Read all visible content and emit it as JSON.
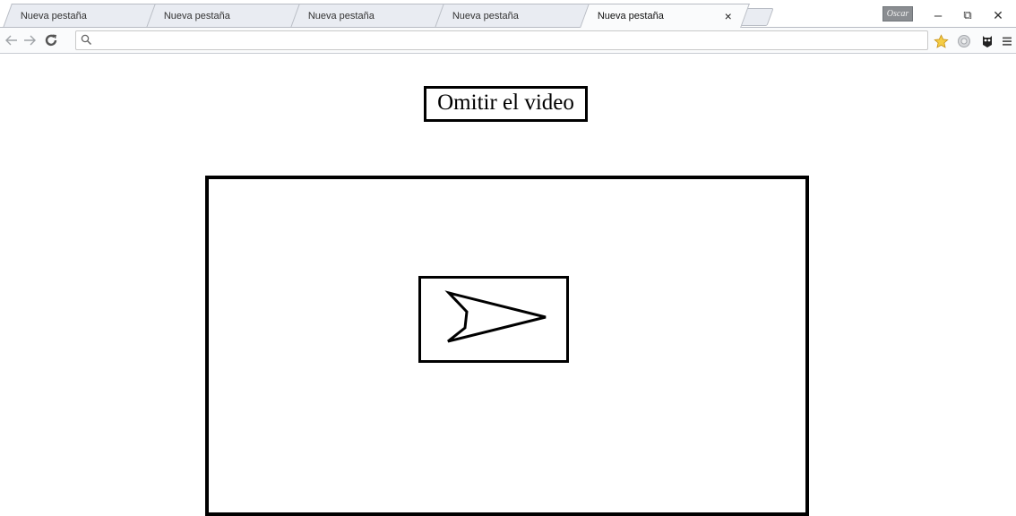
{
  "browser": {
    "tabs": [
      {
        "title": "Nueva pestaña",
        "close_glyph": "×",
        "active": false
      },
      {
        "title": "Nueva pestaña",
        "close_glyph": "×",
        "active": false
      },
      {
        "title": "Nueva pestaña",
        "close_glyph": "×",
        "active": false
      },
      {
        "title": "Nueva pestaña",
        "close_glyph": "×",
        "active": false
      },
      {
        "title": "Nueva pestaña",
        "close_glyph": "×",
        "active": true
      }
    ],
    "profile_name": "Oscar",
    "window_controls": {
      "minimize": "–",
      "restore": "⧉",
      "close": "✕"
    },
    "omnibox": {
      "value": "",
      "placeholder": ""
    },
    "icons": {
      "back": "back-arrow-icon",
      "forward": "forward-arrow-icon",
      "reload": "reload-icon",
      "search": "search-icon",
      "bookmark_star": "star-icon",
      "extension_1": "extension-circle-icon",
      "extension_2": "extension-owl-icon",
      "menu": "hamburger-menu-icon"
    },
    "colors": {
      "star": "#f2c12e",
      "tab_bg": "#e9ecf2",
      "toolbar_bg": "#fafbfc"
    }
  },
  "page": {
    "skip_button_label": "Omitir el video",
    "video": {
      "play_icon": "play-arrow-icon"
    }
  }
}
